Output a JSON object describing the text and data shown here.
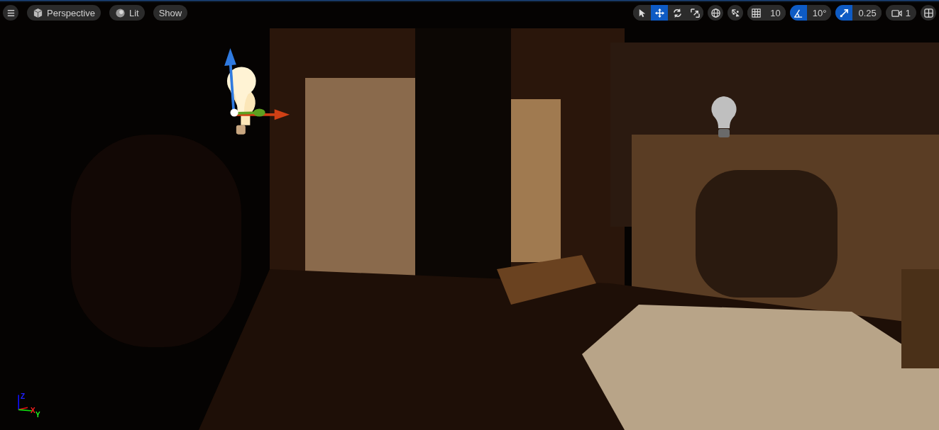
{
  "view_options": [
    {
      "kind": "view_mode",
      "label": "Perspective"
    },
    {
      "kind": "lighting",
      "label": "Lit"
    },
    {
      "kind": "show",
      "label": "Show"
    }
  ],
  "transform_tools": [
    {
      "kind": "select",
      "selected": false
    },
    {
      "kind": "translate",
      "selected": true
    },
    {
      "kind": "rotate",
      "selected": false
    },
    {
      "kind": "scale",
      "selected": false
    }
  ],
  "snaps": [
    {
      "kind": "grid",
      "on": false,
      "value": "10"
    },
    {
      "kind": "angle",
      "on": true,
      "value": "10°"
    },
    {
      "kind": "scale",
      "on": true,
      "value": "0.25"
    }
  ],
  "camera_speed": "1",
  "axis_labels": [
    {
      "kind": "z",
      "label": "Z"
    },
    {
      "kind": "x",
      "label": "X"
    },
    {
      "kind": "y",
      "label": "Y"
    }
  ]
}
